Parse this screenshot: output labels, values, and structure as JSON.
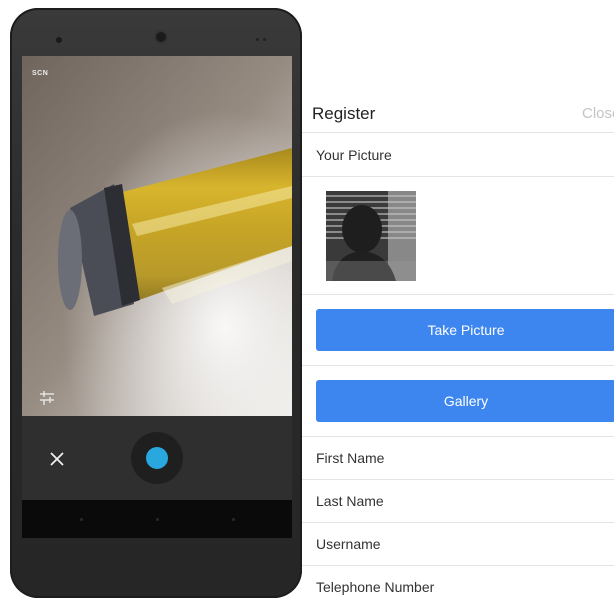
{
  "camera": {
    "scene_mode_label": "SCN",
    "shutter_color": "#29a8e0"
  },
  "register": {
    "title": "Register",
    "close_label": "Close",
    "picture_section_label": "Your Picture",
    "take_picture_label": "Take Picture",
    "gallery_label": "Gallery",
    "fields": [
      {
        "label": "First Name"
      },
      {
        "label": "Last Name"
      },
      {
        "label": "Username"
      },
      {
        "label": "Telephone Number"
      }
    ],
    "button_color": "#3d86f0"
  }
}
